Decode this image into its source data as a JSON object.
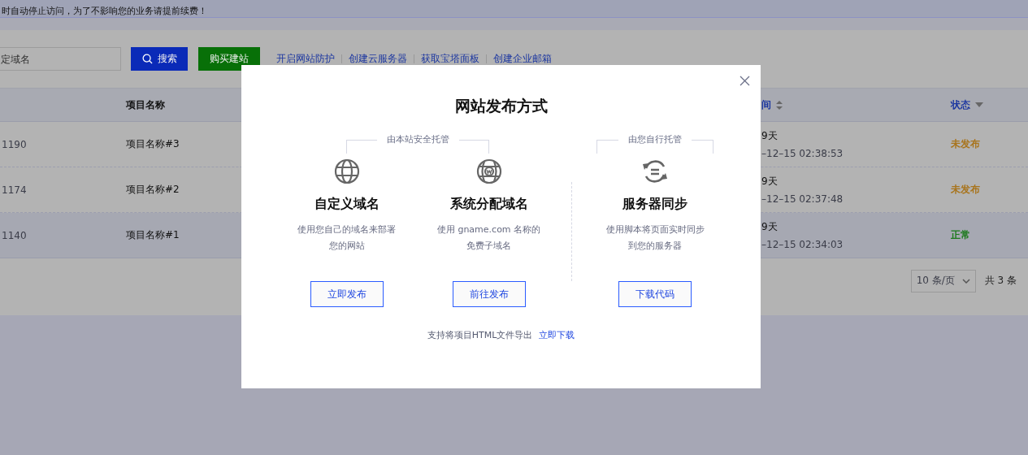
{
  "notice": {
    "text": "时自动停止访问，为了不影响您的业务请提前续费！"
  },
  "toolbar": {
    "search": {
      "placeholder": "定域名"
    },
    "search_button": "搜索",
    "buy_button": "购买建站",
    "links": [
      "开启网站防护",
      "创建云服务器",
      "获取宝塔面板",
      "创建企业邮箱"
    ]
  },
  "table": {
    "columns": [
      {
        "kind": "plain"
      },
      {
        "label": "项目名称",
        "kind": "plain"
      },
      {
        "label": "间",
        "kind": "sort"
      },
      {
        "label": "状态",
        "kind": "filter"
      }
    ],
    "rows": [
      {
        "column_1": "1190",
        "name": "项目名称#3",
        "days": "9天",
        "date": "–12–15 02:38:53",
        "status": "未发布",
        "color": "#a8741c",
        "hovered": false
      },
      {
        "column_1": "1174",
        "name": "项目名称#2",
        "days": "9天",
        "date": "–12–15 02:37:48",
        "status": "未发布",
        "color": "#a8741c",
        "hovered": false
      },
      {
        "column_1": "1140",
        "name": "项目名称#1",
        "days": "9天",
        "date": "–12–15 02:34:03",
        "status": "正常",
        "color": "#1c7a1c",
        "hovered": true
      }
    ]
  },
  "pagination": {
    "page_size": "10 条/页",
    "total": "共 3 条"
  },
  "dialog": {
    "title": "网站发布方式",
    "groups": [
      {
        "label": "由本站安全托管",
        "options": [
          {
            "title": "自定义域名",
            "description": [
              "使用您自己的域名来部署",
              "您的网站"
            ],
            "button": "立即发布"
          },
          {
            "title": "系统分配域名",
            "description": [
              "使用 gname.com 名称的",
              "免费子域名"
            ],
            "button": "前往发布"
          }
        ]
      },
      {
        "label": "由您自行托管",
        "options": [
          {
            "title": "服务器同步",
            "description": [
              "使用脚本将页面实时同步",
              "到您的服务器"
            ],
            "button": "下载代码"
          }
        ]
      }
    ],
    "footer": {
      "text": "支持将项目HTML文件导出",
      "link": "立即下载"
    }
  }
}
